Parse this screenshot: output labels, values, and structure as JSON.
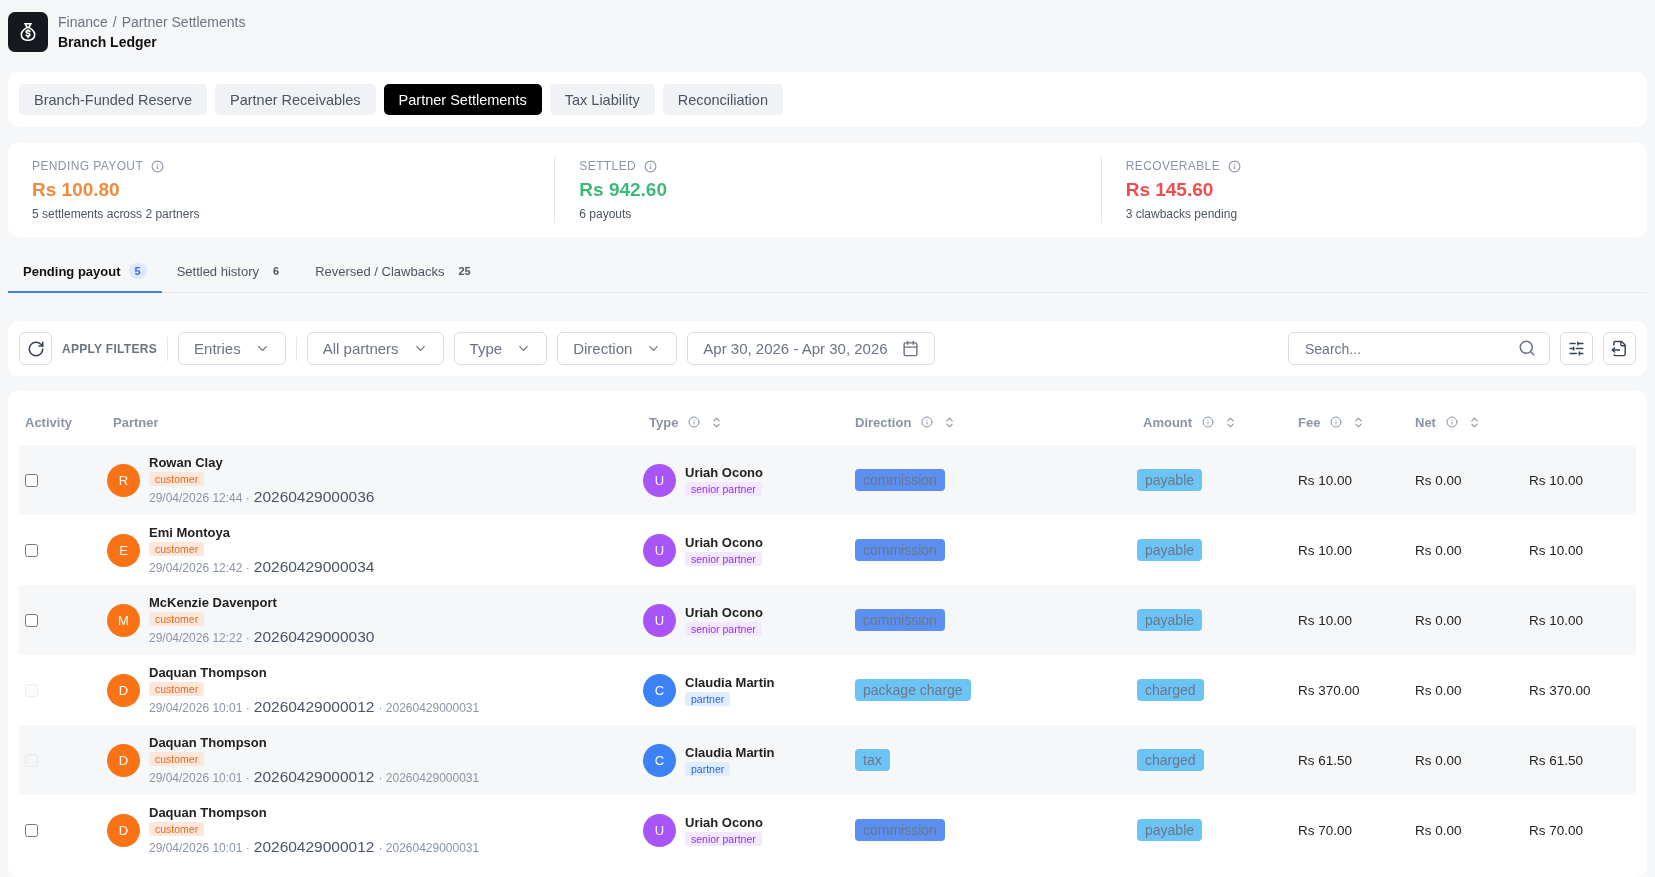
{
  "breadcrumb": {
    "parent": "Finance",
    "separator": "/",
    "current": "Partner Settlements"
  },
  "page_title": "Branch Ledger",
  "section_tabs": [
    {
      "label": "Branch-Funded Reserve",
      "selected": false
    },
    {
      "label": "Partner Receivables",
      "selected": false
    },
    {
      "label": "Partner Settlements",
      "selected": true
    },
    {
      "label": "Tax Liability",
      "selected": false
    },
    {
      "label": "Reconciliation",
      "selected": false
    }
  ],
  "stats": [
    {
      "label": "PENDING PAYOUT",
      "value": "Rs 100.80",
      "note": "5 settlements across 2 partners",
      "color": "#f08a3c"
    },
    {
      "label": "SETTLED",
      "value": "Rs 942.60",
      "note": "6 payouts",
      "color": "#3fb97a"
    },
    {
      "label": "RECOVERABLE",
      "value": "Rs 145.60",
      "note": "3 clawbacks pending",
      "color": "#ef4d4d"
    }
  ],
  "view_tabs": [
    {
      "label": "Pending payout",
      "count": "5",
      "selected": true
    },
    {
      "label": "Settled history",
      "count": "6",
      "selected": false
    },
    {
      "label": "Reversed / Clawbacks",
      "count": "25",
      "selected": false
    }
  ],
  "filters": {
    "apply_label": "APPLY FILTERS",
    "dropdowns": [
      "Entries",
      "All partners",
      "Type",
      "Direction"
    ],
    "date_range": "Apr 30, 2026 - Apr 30, 2026",
    "search": {
      "placeholder": "Search..."
    }
  },
  "table": {
    "columns": [
      {
        "label": "Activity",
        "info": false,
        "sortable": false
      },
      {
        "label": "Partner",
        "info": false,
        "sortable": false
      },
      {
        "label": "Type",
        "info": true,
        "sortable": true
      },
      {
        "label": "Direction",
        "info": true,
        "sortable": true
      },
      {
        "label": "Amount",
        "info": true,
        "sortable": true
      },
      {
        "label": "Fee",
        "info": true,
        "sortable": true
      },
      {
        "label": "Net",
        "info": true,
        "sortable": true
      }
    ],
    "rows": [
      {
        "checked": false,
        "disabled": false,
        "partner": {
          "initial": "R",
          "name": "Rowan Clay",
          "role": "customer",
          "time": "29/04/2026 12:44 ·",
          "reference": "20260429000036"
        },
        "counterparty": {
          "initial": "U",
          "name": "Uriah Ocono",
          "role": "senior partner",
          "color": "#a855f7"
        },
        "direction": {
          "label": "commission",
          "color": "#5b8ff0"
        },
        "status": "payable",
        "amount": "Rs 10.00",
        "fee": "Rs 0.00",
        "net": "Rs 10.00"
      },
      {
        "checked": false,
        "disabled": false,
        "partner": {
          "initial": "E",
          "name": "Emi Montoya",
          "role": "customer",
          "time": "29/04/2026 12:42 ·",
          "reference": "20260429000034"
        },
        "counterparty": {
          "initial": "U",
          "name": "Uriah Ocono",
          "role": "senior partner",
          "color": "#a855f7"
        },
        "direction": {
          "label": "commission",
          "color": "#5b8ff0"
        },
        "status": "payable",
        "amount": "Rs 10.00",
        "fee": "Rs 0.00",
        "net": "Rs 10.00"
      },
      {
        "checked": false,
        "disabled": false,
        "partner": {
          "initial": "M",
          "name": "McKenzie Davenport",
          "role": "customer",
          "time": "29/04/2026 12:22 ·",
          "reference": "20260429000030"
        },
        "counterparty": {
          "initial": "U",
          "name": "Uriah Ocono",
          "role": "senior partner",
          "color": "#a855f7"
        },
        "direction": {
          "label": "commission",
          "color": "#5b8ff0"
        },
        "status": "payable",
        "amount": "Rs 10.00",
        "fee": "Rs 0.00",
        "net": "Rs 10.00"
      },
      {
        "checked": false,
        "disabled": true,
        "partner": {
          "initial": "D",
          "name": "Daquan Thompson",
          "role": "customer",
          "time": "29/04/2026 10:01 ·",
          "reference": "20260429000012",
          "linked_reference": "· 20260429000031"
        },
        "counterparty": {
          "initial": "C",
          "name": "Claudia Martin",
          "role": "partner",
          "color": "#3b82f6"
        },
        "direction": {
          "label": "package charge",
          "color": "#6cc4f6"
        },
        "status": "charged",
        "amount": "Rs 370.00",
        "fee": "Rs 0.00",
        "net": "Rs 370.00"
      },
      {
        "checked": false,
        "disabled": true,
        "partner": {
          "initial": "D",
          "name": "Daquan Thompson",
          "role": "customer",
          "time": "29/04/2026 10:01 ·",
          "reference": "20260429000012",
          "linked_reference": "· 20260429000031"
        },
        "counterparty": {
          "initial": "C",
          "name": "Claudia Martin",
          "role": "partner",
          "color": "#3b82f6"
        },
        "direction": {
          "label": "tax",
          "color": "#6cc4f6"
        },
        "status": "charged",
        "amount": "Rs 61.50",
        "fee": "Rs 0.00",
        "net": "Rs 61.50"
      },
      {
        "checked": false,
        "disabled": false,
        "partner": {
          "initial": "D",
          "name": "Daquan Thompson",
          "role": "customer",
          "time": "29/04/2026 10:01 ·",
          "reference": "20260429000012",
          "linked_reference": "· 20260429000031"
        },
        "counterparty": {
          "initial": "U",
          "name": "Uriah Ocono",
          "role": "senior partner",
          "color": "#a855f7"
        },
        "direction": {
          "label": "commission",
          "color": "#5b8ff0"
        },
        "status": "payable",
        "amount": "Rs 70.00",
        "fee": "Rs 0.00",
        "net": "Rs 70.00"
      }
    ]
  }
}
